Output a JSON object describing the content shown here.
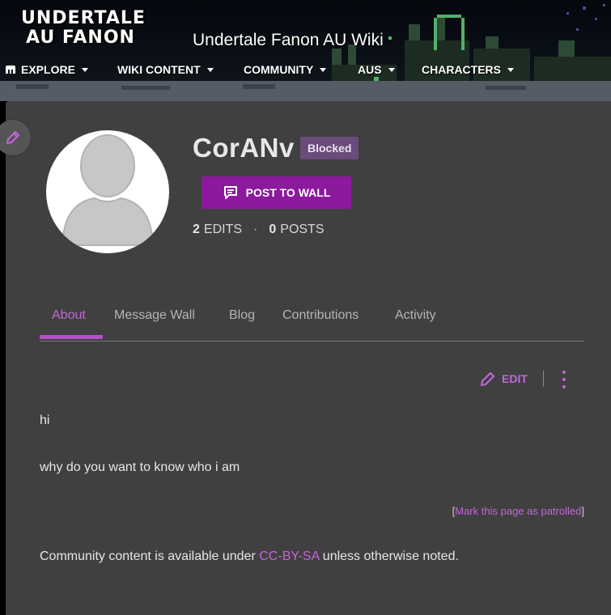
{
  "header": {
    "logo_line1": "UNDERTALE",
    "logo_line2": "AU FANON",
    "wiki_title": "Undertale Fanon AU Wiki",
    "nav": [
      {
        "label": "EXPLORE",
        "icon": "explore-icon"
      },
      {
        "label": "WIKI CONTENT"
      },
      {
        "label": "COMMUNITY"
      },
      {
        "label": "AUS"
      },
      {
        "label": "CHARACTERS"
      }
    ]
  },
  "profile": {
    "username": "CorANv",
    "badge": "Blocked",
    "post_button": "POST TO WALL",
    "edits_count": "2",
    "edits_label": "EDITS",
    "separator": "·",
    "posts_count": "0",
    "posts_label": "POSTS"
  },
  "tabs": [
    {
      "label": "About",
      "active": true
    },
    {
      "label": "Message Wall"
    },
    {
      "label": "Blog"
    },
    {
      "label": "Contributions"
    },
    {
      "label": "Activity"
    }
  ],
  "about": {
    "edit_label": "EDIT",
    "lines": [
      "hi",
      "why do you want to know who i am"
    ],
    "patrol_open": "[",
    "patrol_link": "Mark this page as patrolled",
    "patrol_close": "]"
  },
  "footer": {
    "license_prefix": "Community content is available under ",
    "license_link": "CC-BY-SA",
    "license_suffix": " unless otherwise noted."
  },
  "colors": {
    "accent": "#c267d8",
    "button": "#8b1a9c",
    "panel": "#404040",
    "badge": "#6a4b7c"
  }
}
